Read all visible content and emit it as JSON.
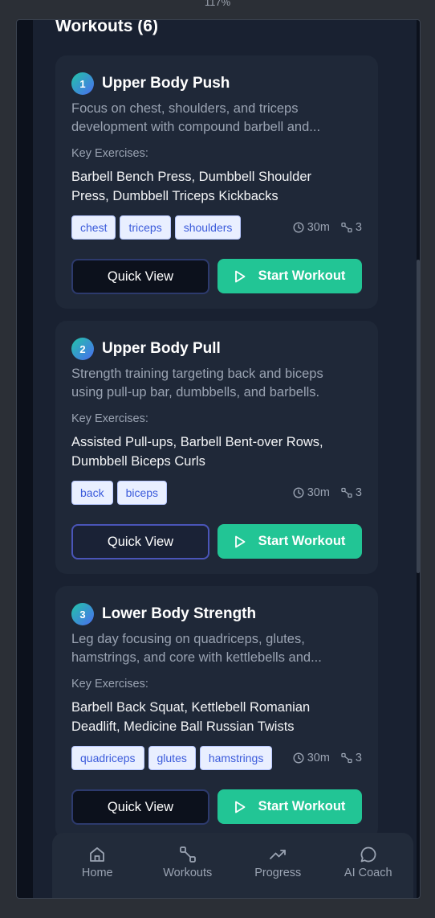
{
  "zoom_level": "117%",
  "section": {
    "title": "Workouts (6)"
  },
  "workouts": [
    {
      "number": "1",
      "title": "Upper Body Push",
      "description": "Focus on chest, shoulders, and triceps\ndevelopment with compound barbell and...",
      "key_label": "Key Exercises:",
      "exercises": "Barbell Bench Press, Dumbbell Shoulder\nPress, Dumbbell Triceps Kickbacks",
      "tags": [
        "chest",
        "triceps",
        "shoulders"
      ],
      "duration": "30m",
      "count": "3",
      "quick_view_label": "Quick View",
      "start_label": "Start Workout"
    },
    {
      "number": "2",
      "title": "Upper Body Pull",
      "description": "Strength training targeting back and biceps\nusing pull-up bar, dumbbells, and barbells.",
      "key_label": "Key Exercises:",
      "exercises": "Assisted Pull-ups, Barbell Bent-over Rows,\nDumbbell Biceps Curls",
      "tags": [
        "back",
        "biceps"
      ],
      "duration": "30m",
      "count": "3",
      "quick_view_label": "Quick View",
      "start_label": "Start Workout"
    },
    {
      "number": "3",
      "title": "Lower Body Strength",
      "description": "Leg day focusing on quadriceps, glutes,\nhamstrings, and core with kettlebells and...",
      "key_label": "Key Exercises:",
      "exercises": "Barbell Back Squat, Kettlebell Romanian\nDeadlift, Medicine Ball Russian Twists",
      "tags": [
        "quadriceps",
        "glutes",
        "hamstrings"
      ],
      "duration": "30m",
      "count": "3",
      "quick_view_label": "Quick View",
      "start_label": "Start Workout"
    }
  ],
  "nav": {
    "items": [
      {
        "label": "Home",
        "icon": "home-icon"
      },
      {
        "label": "Workouts",
        "icon": "dumbbell-icon"
      },
      {
        "label": "Progress",
        "icon": "trending-up-icon"
      },
      {
        "label": "AI Coach",
        "icon": "chat-bubble-icon"
      }
    ]
  },
  "colors": {
    "accent": "#22c595",
    "background": "#192131",
    "card": "#1f2838",
    "tag_bg": "#e9efff",
    "tag_text": "#3b5bdb"
  }
}
